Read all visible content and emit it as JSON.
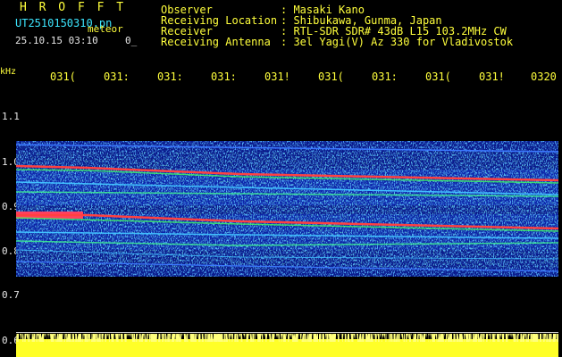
{
  "brand": "H R O F F T",
  "filename": "UT2510150310.pn",
  "program_label": "meteor",
  "date_time": "25.10.15 03:10",
  "date_time_extra": "0_",
  "info": [
    {
      "label": "Observer",
      "value": ": Masaki Kano"
    },
    {
      "label": "Receiving Location",
      "value": ": Shibukawa, Gunma, Japan"
    },
    {
      "label": "Receiver",
      "value": ": RTL-SDR SDR# 43dB L15 103.2MHz CW"
    },
    {
      "label": "Receiving Antenna",
      "value": ": 3el Yagi(V) Az 330 for Vladivostok"
    }
  ],
  "unit_label": "kHz",
  "time_ticks": [
    "031(",
    "031:",
    "031:",
    "031:",
    "031!",
    "031(",
    "031:",
    "031(",
    "031!",
    "0320"
  ],
  "y_ticks": [
    "1.1",
    "1.0",
    "0.9",
    "0.8",
    "0.7",
    "0.6"
  ],
  "colors": {
    "label": "#ffff3c",
    "info": "#3ce6ff",
    "axis": "#e6e6e6",
    "background": "#000000"
  }
}
